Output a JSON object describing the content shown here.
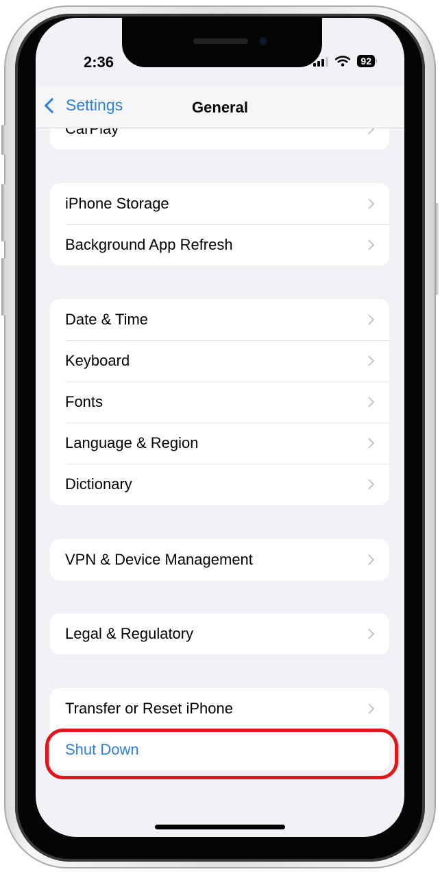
{
  "status_bar": {
    "time": "2:36",
    "battery": "92"
  },
  "nav": {
    "back_label": "Settings",
    "title": "General"
  },
  "groups": [
    {
      "items": [
        {
          "label": "CarPlay",
          "chevron": true
        }
      ]
    },
    {
      "items": [
        {
          "label": "iPhone Storage",
          "chevron": true
        },
        {
          "label": "Background App Refresh",
          "chevron": true
        }
      ]
    },
    {
      "items": [
        {
          "label": "Date & Time",
          "chevron": true
        },
        {
          "label": "Keyboard",
          "chevron": true
        },
        {
          "label": "Fonts",
          "chevron": true
        },
        {
          "label": "Language & Region",
          "chevron": true
        },
        {
          "label": "Dictionary",
          "chevron": true
        }
      ]
    },
    {
      "items": [
        {
          "label": "VPN & Device Management",
          "chevron": true
        }
      ]
    },
    {
      "items": [
        {
          "label": "Legal & Regulatory",
          "chevron": true
        }
      ]
    },
    {
      "items": [
        {
          "label": "Transfer or Reset iPhone",
          "chevron": true
        },
        {
          "label": "Shut Down",
          "chevron": false
        }
      ]
    }
  ],
  "colors": {
    "accent": "#2f7fd6",
    "highlight": "#e4141b",
    "background": "#f1f1f6"
  }
}
